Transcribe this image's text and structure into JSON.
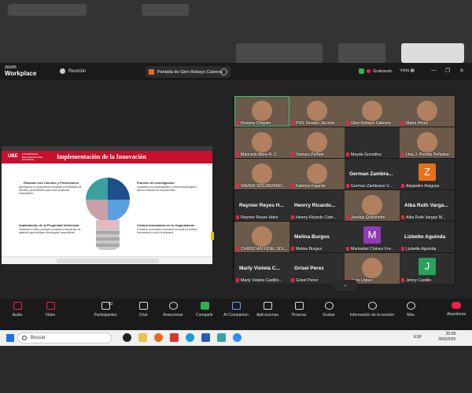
{
  "app": {
    "logo_line1": "zoom",
    "logo_line2": "Workplace",
    "meeting_label": "Reunión"
  },
  "share_tab": {
    "label": "Pantalla de Glen Robayo Cabrera"
  },
  "status": {
    "recording": "Grabando",
    "view": "Vista"
  },
  "slide": {
    "brand": "UBE",
    "brand_sub": "UNIVERSIDAD BOLIVARIANA DEL ECUADOR",
    "title": "Implementación de la Innovación",
    "blocks": [
      {
        "head": "Relación con Clientes y Proveedores",
        "text": "Aprovechar el conocimiento mediante la flexibilidad de clientes y proveedores para crear productos innovadores."
      },
      {
        "head": "Fuentes de Investigación",
        "text": "Colaborar con universidades y centros tecnológicos para la creación de conocimiento."
      },
      {
        "head": "Implantación de la Propiedad Intelectual",
        "text": "Gestionar el valor, proteger y explotar el desarrollo de patentes para proteger tecnologías competitivas."
      },
      {
        "head": "Cultura Innovadora en la Organización",
        "text": "Fomentar una cultura innovadora a todos los niveles, involucrando a todo el personal."
      }
    ]
  },
  "participants": [
    {
      "name": "Roxana Chiquito",
      "kind": "cam",
      "selected": true
    },
    {
      "name": "PhD. Renato Jácome",
      "kind": "cam"
    },
    {
      "name": "Glen Robayo Cabrera",
      "kind": "cam"
    },
    {
      "name": "María Pérez",
      "kind": "cam"
    },
    {
      "name": "Maricielo Mora R. C.",
      "kind": "cam"
    },
    {
      "name": "Yamara Peñate",
      "kind": "cam"
    },
    {
      "name": "Mayda González",
      "kind": "empty"
    },
    {
      "name": "Lina J. Portela Peñalver",
      "kind": "cam"
    },
    {
      "name": "XAVIER SOLORZANO ...",
      "kind": "cam"
    },
    {
      "name": "Fabricio Fajardo",
      "kind": "cam"
    },
    {
      "name": "German Zambrano V...",
      "big": "German Zambra...",
      "kind": "text"
    },
    {
      "name": "Alejandro Reigosa",
      "initial": "Z",
      "color": "#e8701a",
      "kind": "initial"
    },
    {
      "name": "Reynier Reyes Hdez",
      "big": "Reynier Reyes H...",
      "kind": "text"
    },
    {
      "name": "Henrry Ricardo Cabr...",
      "big": "Henrry Ricardo...",
      "kind": "text"
    },
    {
      "name": "Jessica Quichimbo",
      "kind": "cam"
    },
    {
      "name": "Alba Ruth Vargas M...",
      "big": "Alba Ruth Varga...",
      "kind": "text"
    },
    {
      "name": "CHRISTIAN FIDEL SOL...",
      "kind": "cam"
    },
    {
      "name": "Melina Burgos",
      "big": "Melina Burgos",
      "kind": "text"
    },
    {
      "name": "Marisabel Chávez Fre...",
      "initial": "M",
      "color": "#8e3bb5",
      "kind": "initial"
    },
    {
      "name": "Lizbette Aguinda",
      "big": "Lizbette Aguinda",
      "kind": "text"
    },
    {
      "name": "Marly Violeta Castillo...",
      "big": "Marly Violeta C...",
      "kind": "text"
    },
    {
      "name": "Grisel Perez",
      "big": "Grisel Perez",
      "kind": "text"
    },
    {
      "name": "Juan López",
      "kind": "cam"
    },
    {
      "name": "Jenny Castillo",
      "initial": "J",
      "color": "#2aa05a",
      "kind": "initial"
    }
  ],
  "toolbar": {
    "audio": "Audio",
    "video": "Video",
    "participants": "Participantes",
    "participants_count": "62",
    "chat": "Chat",
    "react": "Reaccionar",
    "share": "Compartir",
    "ai": "AI Companion",
    "apps": "Aplicaciones",
    "whiteboards": "Pizarras",
    "record": "Grabar",
    "info": "Información de la reunión",
    "more": "Más",
    "leave": "Abandonar"
  },
  "taskbar": {
    "search_placeholder": "Buscar",
    "lang": "ESP",
    "time": "20:08",
    "date": "30/6/2025"
  },
  "colors": {
    "zoom_blue": "#0b5cff",
    "record_red": "#e22244",
    "share_green": "#2bb24c",
    "ube_red": "#c8102e"
  }
}
